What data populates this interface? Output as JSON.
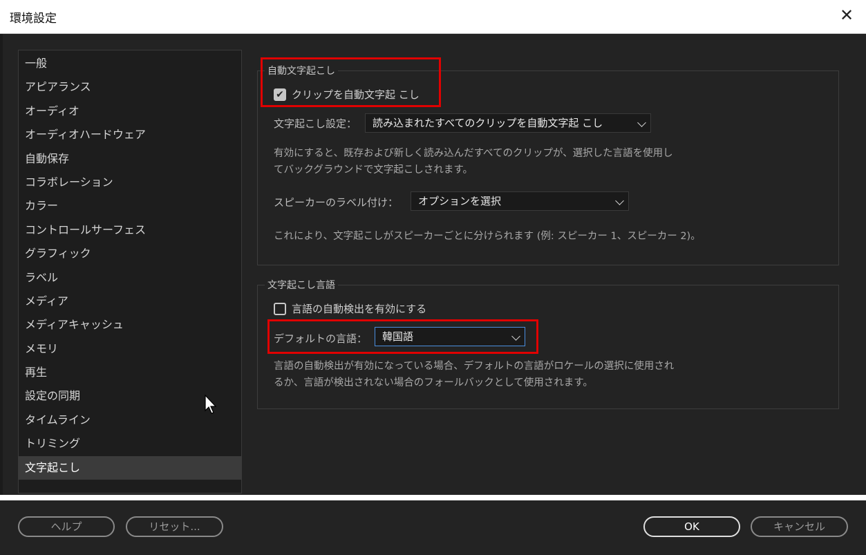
{
  "window": {
    "title": "環境設定",
    "close_label": "✕"
  },
  "sidebar": {
    "items": [
      {
        "label": "一般"
      },
      {
        "label": "アピアランス"
      },
      {
        "label": "オーディオ"
      },
      {
        "label": "オーディオハードウェア"
      },
      {
        "label": "自動保存"
      },
      {
        "label": "コラボレーション"
      },
      {
        "label": "カラー"
      },
      {
        "label": "コントロールサーフェス"
      },
      {
        "label": "グラフィック"
      },
      {
        "label": "ラベル"
      },
      {
        "label": "メディア"
      },
      {
        "label": "メディアキャッシュ"
      },
      {
        "label": "メモリ"
      },
      {
        "label": "再生"
      },
      {
        "label": "設定の同期"
      },
      {
        "label": "タイムライン"
      },
      {
        "label": "トリミング"
      },
      {
        "label": "文字起こし",
        "active": true
      }
    ]
  },
  "auto_transcription": {
    "group_title": "自動文字起こし",
    "checkbox_label": "クリップを自動文字起 こし",
    "checkbox_checked": true,
    "setting_label": "文字起こし設定：",
    "setting_value": "読み込まれたすべてのクリップを自動文字起 こし",
    "setting_desc_line1": "有効にすると、既存および新しく読み込んだすべてのクリップが、選択した言語を使用し",
    "setting_desc_line2": "てバックグラウンドで文字起こしされます。",
    "speaker_label": "スピーカーのラベル付け：",
    "speaker_value": "オプションを選択",
    "speaker_desc": "これにより、文字起こしがスピーカーごとに分けられます (例: スピーカー 1、スピーカー 2)。"
  },
  "language": {
    "group_title": "文字起こし言語",
    "autodetect_label": "言語の自動検出を有効にする",
    "autodetect_checked": false,
    "default_label": "デフォルトの言語：",
    "default_value": "韓国語",
    "desc_line1": "言語の自動検出が有効になっている場合、デフォルトの言語がロケールの選択に使用され",
    "desc_line2": "るか、言語が検出されない場合のフォールバックとして使用されます。"
  },
  "footer": {
    "help_label": "ヘルプ",
    "reset_label": "リセット...",
    "ok_label": "OK",
    "cancel_label": "キャンセル"
  },
  "colors": {
    "highlight": "#e00000",
    "focus": "#4a8fe0",
    "background": "#232323"
  }
}
